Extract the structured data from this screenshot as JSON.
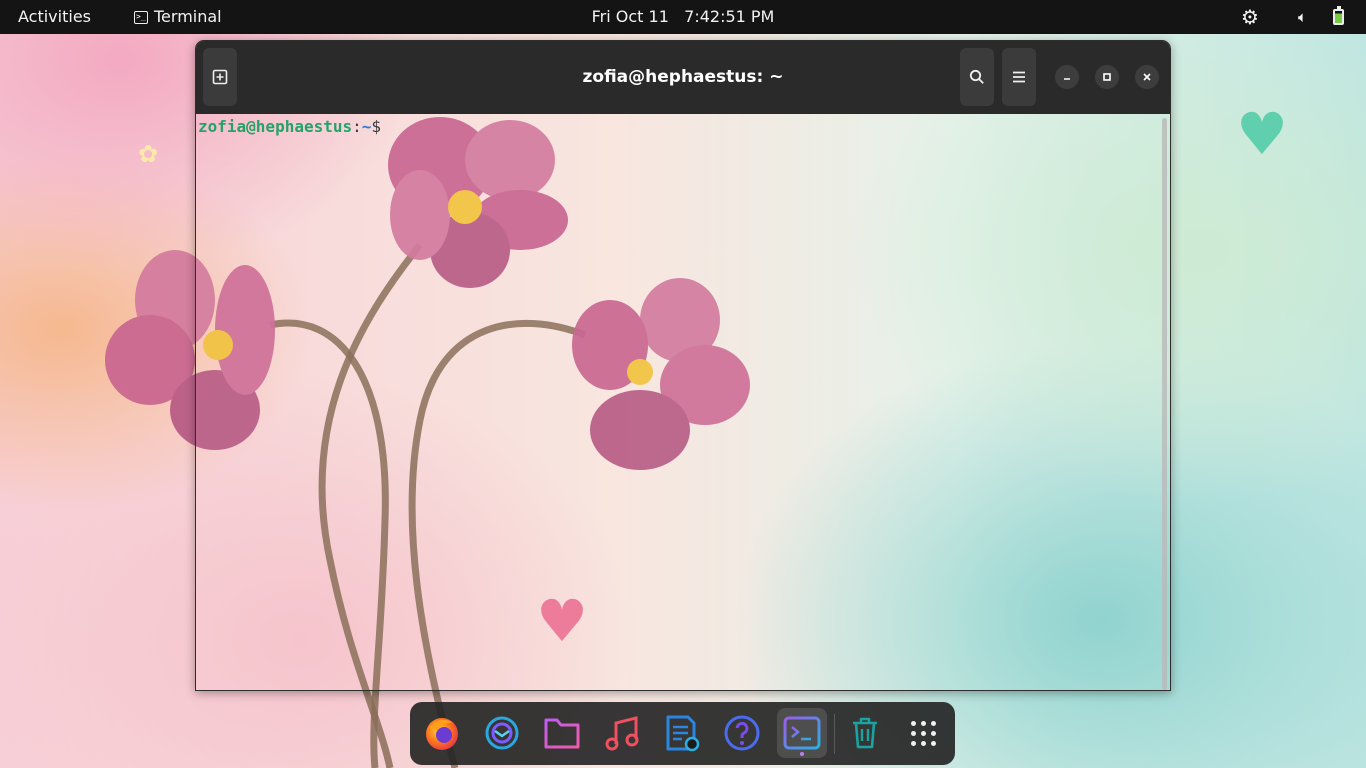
{
  "topbar": {
    "activities": "Activities",
    "app_name": "Terminal",
    "clock": "Fri Oct 11   7:42:51 PM",
    "icons": [
      "settings-gear-icon",
      "volume-icon",
      "battery-icon"
    ]
  },
  "terminal": {
    "title": "zofia@hephaestus: ~",
    "prompt_user": "zofia@hephaestus",
    "prompt_sep": ":",
    "prompt_dir": "~",
    "prompt_symbol": "$",
    "icons": [
      "new-tab-icon",
      "search-icon",
      "hamburger-menu-icon",
      "minimize-icon",
      "maximize-icon",
      "close-icon"
    ]
  },
  "dock": {
    "items": [
      {
        "name": "firefox",
        "icon": "firefox-icon"
      },
      {
        "name": "thunderbird",
        "icon": "mail-icon"
      },
      {
        "name": "files",
        "icon": "folder-icon"
      },
      {
        "name": "music",
        "icon": "music-note-icon"
      },
      {
        "name": "text-editor",
        "icon": "document-icon"
      },
      {
        "name": "help",
        "icon": "help-icon"
      },
      {
        "name": "terminal",
        "icon": "terminal-icon",
        "active": true
      },
      {
        "name": "trash",
        "icon": "trash-icon"
      },
      {
        "name": "show-apps",
        "icon": "app-grid-icon"
      }
    ]
  },
  "colors": {
    "topbar_bg": "#141414",
    "headerbar_bg": "#2a2a2a",
    "prompt_user": "#26a269",
    "prompt_dir": "#2a7bde",
    "accent": "#b67ff5"
  }
}
